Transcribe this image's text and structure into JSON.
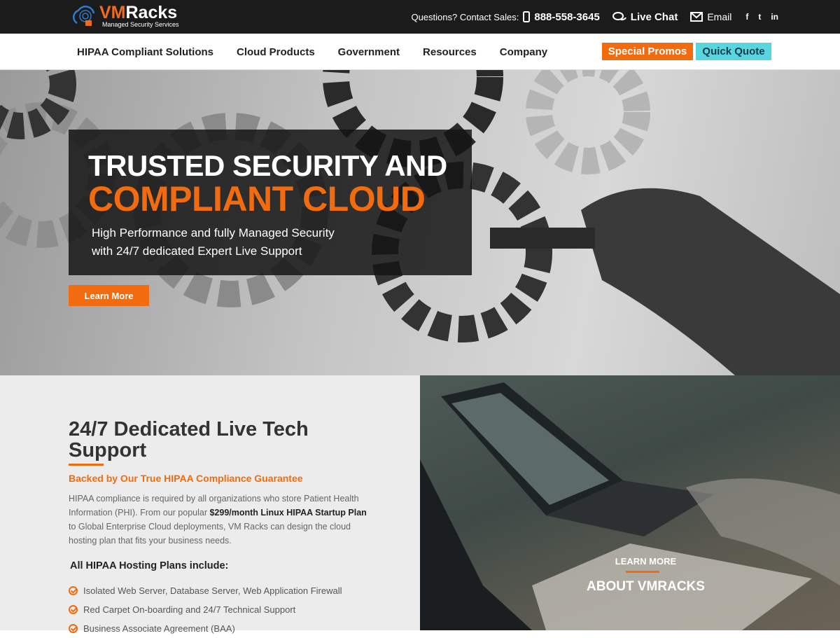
{
  "topbar": {
    "logo_vm": "VM",
    "logo_racks": "Racks",
    "logo_sub": "Managed Security Services",
    "contact_label": "Questions? Contact Sales:",
    "phone": "888-558-3645",
    "live_chat": "Live Chat",
    "email": "Email",
    "social": [
      "f",
      "t",
      "in"
    ]
  },
  "nav": {
    "items": [
      "HIPAA Compliant Solutions",
      "Cloud Products",
      "Government",
      "Resources",
      "Company"
    ],
    "promo": "Special Promos",
    "quote": "Quick Quote"
  },
  "hero": {
    "title_line1": "TRUSTED SECURITY AND",
    "title_line2": "COMPLIANT CLOUD",
    "subtitle_line1": "High Performance and fully Managed Security",
    "subtitle_line2": "with 24/7 dedicated Expert Live Support",
    "cta": "Learn More"
  },
  "support": {
    "heading": "24/7 Dedicated Live Tech Support",
    "tagline": "Backed by Our True HIPAA Compliance Guarantee",
    "para_1": "HIPAA compliance is required by all organizations who store Patient Health Information (PHI). From our popular ",
    "para_bold": "$299/month Linux HIPAA Startup Plan",
    "para_2": " to Global Enterprise Cloud deployments, VM Racks can design the cloud hosting plan that fits your business needs.",
    "includes_title": "All HIPAA Hosting Plans include:",
    "includes": [
      "Isolated Web Server, Database Server, Web Application Firewall",
      "Red Carpet On-boarding and 24/7 Technical Support",
      "Business Associate Agreement (BAA)"
    ]
  },
  "about": {
    "line1": "LEARN MORE",
    "line2": "ABOUT VMRACKS"
  },
  "colors": {
    "accent": "#f26b0f",
    "quote": "#58d6e0",
    "topbar": "#1c1b1b"
  }
}
